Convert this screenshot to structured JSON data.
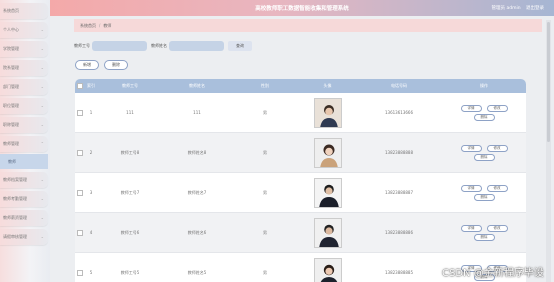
{
  "header": {
    "title": "高校教师职工数据智能收集和管理系统",
    "user": "管理员 admin",
    "logout": "退出登录"
  },
  "sidebar": {
    "items": [
      {
        "label": "系统首页"
      },
      {
        "label": "个人中心"
      },
      {
        "label": "学院管理"
      },
      {
        "label": "院系管理"
      },
      {
        "label": "部门管理"
      },
      {
        "label": "职位管理"
      },
      {
        "label": "职称管理"
      },
      {
        "label": "教师管理"
      }
    ],
    "sub": {
      "label": "教师"
    },
    "items_after": [
      {
        "label": "教师档案管理"
      },
      {
        "label": "教师考勤管理"
      },
      {
        "label": "教师薪资管理"
      },
      {
        "label": "请假审核管理"
      }
    ]
  },
  "breadcrumb": {
    "home": "系统首页",
    "sep": "/",
    "current": "教师"
  },
  "search": {
    "field1_label": "教师工号",
    "field2_label": "教师姓名",
    "query_button": "查询"
  },
  "actions": {
    "add": "新增",
    "delete": "删除"
  },
  "table": {
    "columns": [
      "",
      "索引",
      "教师工号",
      "教师姓名",
      "性别",
      "头像",
      "电话号码",
      "操作"
    ],
    "rows": [
      {
        "index": "1",
        "id": "111",
        "name": "111",
        "gender": "男",
        "phone": "13613613666"
      },
      {
        "index": "2",
        "id": "教师工号8",
        "name": "教师姓名8",
        "gender": "男",
        "phone": "13823888888"
      },
      {
        "index": "3",
        "id": "教师工号7",
        "name": "教师姓名7",
        "gender": "男",
        "phone": "13823888887"
      },
      {
        "index": "4",
        "id": "教师工号6",
        "name": "教师姓名6",
        "gender": "男",
        "phone": "13823888886"
      },
      {
        "index": "5",
        "id": "教师工号5",
        "name": "教师姓名5",
        "gender": "男",
        "phone": "13823888885"
      }
    ],
    "ops": {
      "detail": "详情",
      "edit": "修改",
      "delete": "删除"
    }
  },
  "watermark": "CSDN @金新程序毕设",
  "colors": {
    "topbar_start": "#f4a9a9",
    "topbar_end": "#a6b6d3",
    "accent": "#8ea2c6",
    "table_header": "#a9bfdc"
  }
}
